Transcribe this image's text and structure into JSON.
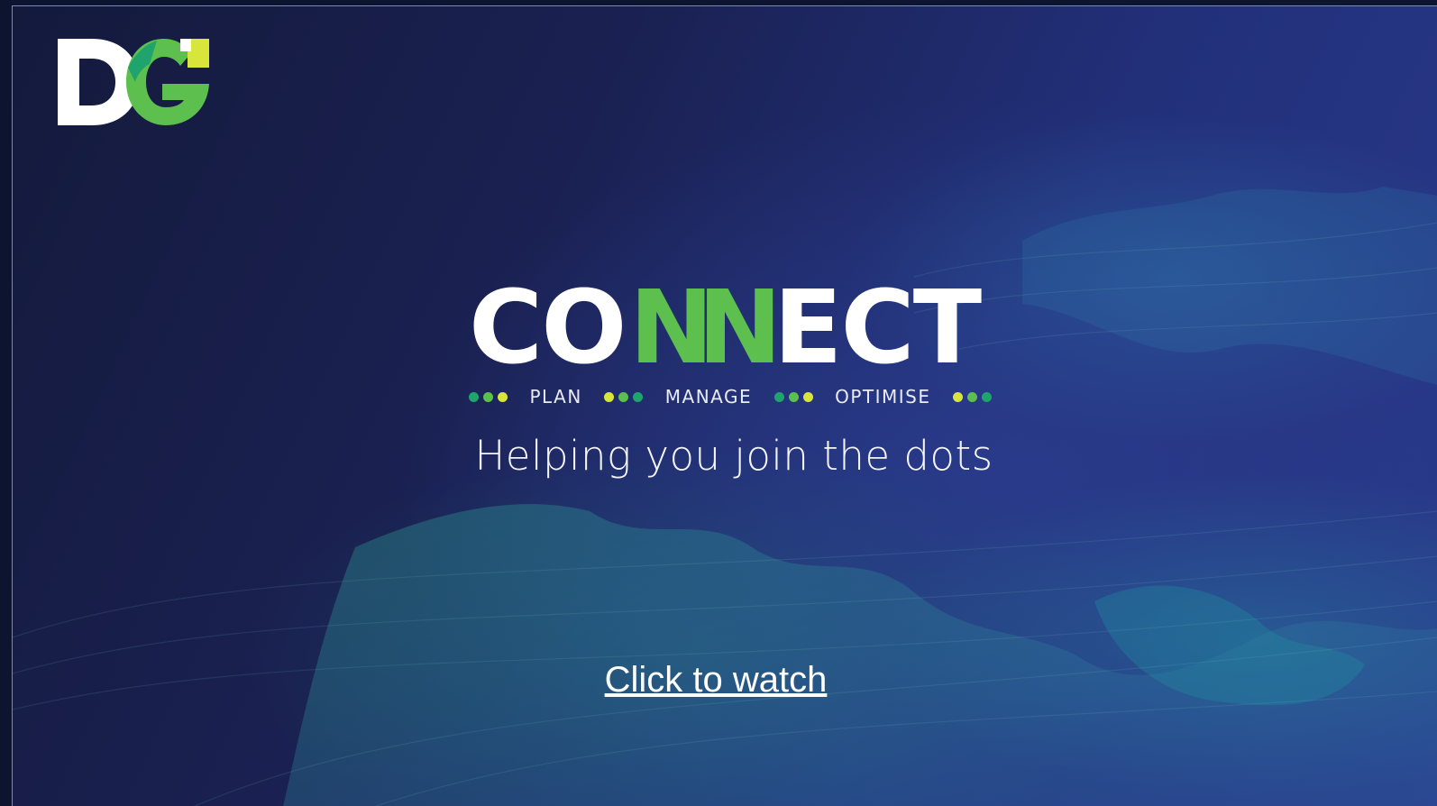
{
  "brand": {
    "logo_letters": "DG",
    "logo_icon": "dg-logo-icon"
  },
  "hero": {
    "title_part1": "CO",
    "title_part2": "NN",
    "title_part3": "ECT",
    "tagline": [
      "PLAN",
      "MANAGE",
      "OPTIMISE"
    ],
    "subtitle": "Helping you join the dots"
  },
  "cta": {
    "label": "Click to watch"
  },
  "colors": {
    "background": "#1a2152",
    "accent_green": "#5cbf4e",
    "accent_yellow": "#d8e53a",
    "accent_teal": "#1fa46e",
    "text": "#ffffff"
  }
}
